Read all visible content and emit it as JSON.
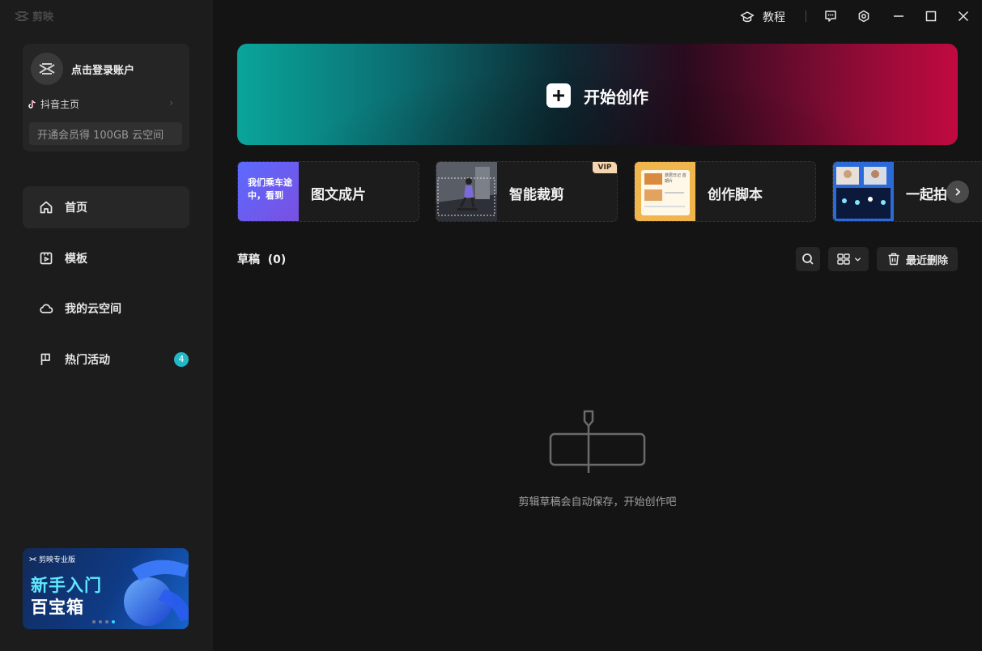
{
  "app": {
    "name": "剪映"
  },
  "account": {
    "login_text": "点击登录账户",
    "douyin_label": "抖音主页",
    "vip_promo": "开通会员得 100GB 云空间"
  },
  "nav": {
    "items": [
      {
        "label": "首页",
        "icon": "home-icon"
      },
      {
        "label": "模板",
        "icon": "template-icon"
      },
      {
        "label": "我的云空间",
        "icon": "cloud-icon"
      },
      {
        "label": "热门活动",
        "icon": "flag-icon",
        "badge": "4"
      }
    ]
  },
  "promo": {
    "tag": "剪映专业版",
    "line1": "新手入门",
    "line2": "百宝箱"
  },
  "titlebar": {
    "tutorial_label": "教程"
  },
  "main": {
    "create_label": "开始创作",
    "tools": [
      {
        "label": "图文成片",
        "thumb_text": "我们乘车途中，看到"
      },
      {
        "label": "智能裁剪",
        "badge": "VIP"
      },
      {
        "label": "创作脚本",
        "thumb_text": "旅居日记 首期片"
      },
      {
        "label": "一起拍"
      }
    ],
    "drafts_title": "草稿  (0)",
    "recent_delete_label": "最近删除",
    "empty_text": "剪辑草稿会自动保存，开始创作吧"
  },
  "colors": {
    "accent_badge": "#22b8c8",
    "banner_left": "#0aa59b",
    "banner_right": "#c10a40",
    "vip_badge": "#f6d6b0"
  }
}
